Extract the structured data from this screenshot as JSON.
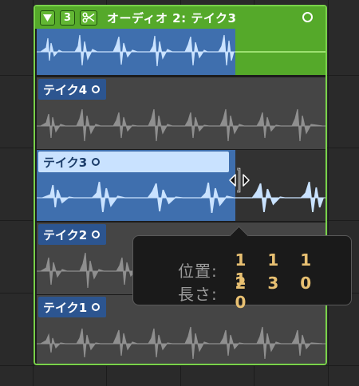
{
  "folder": {
    "disclosure_icon": "triangle-down-icon",
    "take_count": "3",
    "scissors_icon": "scissors-icon",
    "title": "オーディオ 2: テイク3",
    "circle_icon": "circle-icon"
  },
  "takes": [
    {
      "label": "テイク4"
    },
    {
      "label": "テイク3"
    },
    {
      "label": "テイク2"
    },
    {
      "label": "テイク1"
    }
  ],
  "tooltip": {
    "position_label": "位置:",
    "position_value": "1 1 1 1",
    "length_label": "長さ:",
    "length_value": "2 3 0 0"
  },
  "colors": {
    "folder_green": "#55a92a",
    "selected_blue": "#3f6fae",
    "tooltip_value": "#e8c072"
  }
}
